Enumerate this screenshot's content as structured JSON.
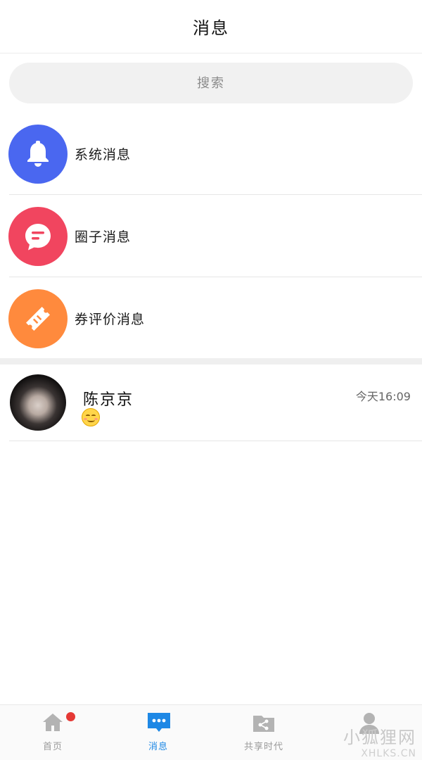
{
  "header": {
    "title": "消息"
  },
  "search": {
    "placeholder": "搜索"
  },
  "categories": [
    {
      "label": "系统消息",
      "icon": "bell-icon",
      "color": "#4a67f0"
    },
    {
      "label": "圈子消息",
      "icon": "chat-bubble-icon",
      "color": "#f1455f"
    },
    {
      "label": "券评价消息",
      "icon": "ticket-icon",
      "color": "#ff8a3d"
    }
  ],
  "chats": [
    {
      "name": "陈京京",
      "time": "今天16:09",
      "preview_icon": "smile-emoji-icon"
    }
  ],
  "tabbar": {
    "items": [
      {
        "label": "首页",
        "icon": "home-icon",
        "active": false,
        "badge": true
      },
      {
        "label": "消息",
        "icon": "message-icon",
        "active": true,
        "badge": false
      },
      {
        "label": "共享时代",
        "icon": "share-folder-icon",
        "active": false,
        "badge": false
      },
      {
        "label": "",
        "icon": "user-icon",
        "active": false,
        "badge": false
      }
    ],
    "active_color": "#1e88e5",
    "inactive_color": "#b3b3b3"
  },
  "watermark": {
    "line1": "小狐狸网",
    "line2": "XHLKS.CN"
  }
}
